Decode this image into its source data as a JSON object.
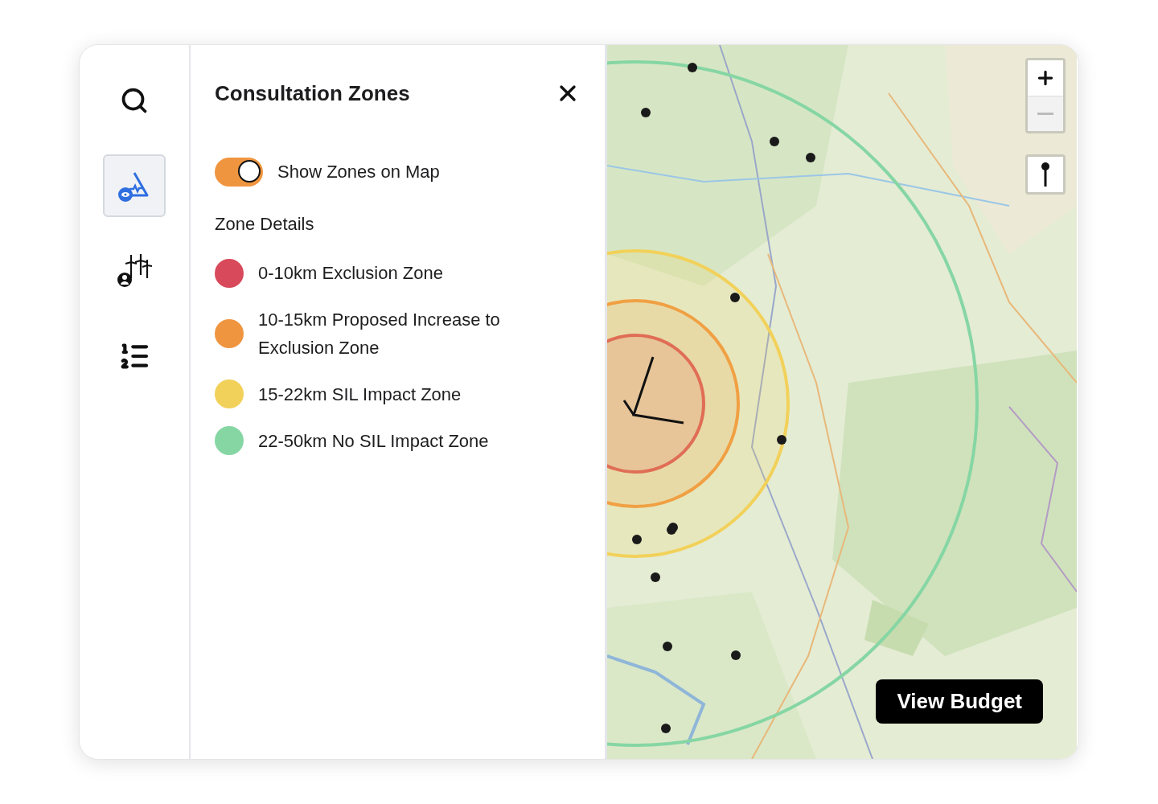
{
  "sidebar": {
    "items": [
      {
        "kind": "search",
        "selected": false
      },
      {
        "kind": "zones",
        "selected": true
      },
      {
        "kind": "turbines",
        "selected": false
      },
      {
        "kind": "list",
        "selected": false
      }
    ]
  },
  "panel": {
    "title": "Consultation Zones",
    "toggle": {
      "label": "Show Zones on Map",
      "on": true
    },
    "section_title": "Zone Details",
    "zones": [
      {
        "label": "0-10km Exclusion Zone",
        "color": "#d84a5b"
      },
      {
        "label": "10-15km Proposed Increase to Exclusion Zone",
        "color": "#f0953f"
      },
      {
        "label": "15-22km SIL Impact Zone",
        "color": "#f2d15a"
      },
      {
        "label": "22-50km No SIL Impact Zone",
        "color": "#86d6a4"
      }
    ]
  },
  "map": {
    "zoom_out_disabled": true,
    "button": "View Budget"
  }
}
